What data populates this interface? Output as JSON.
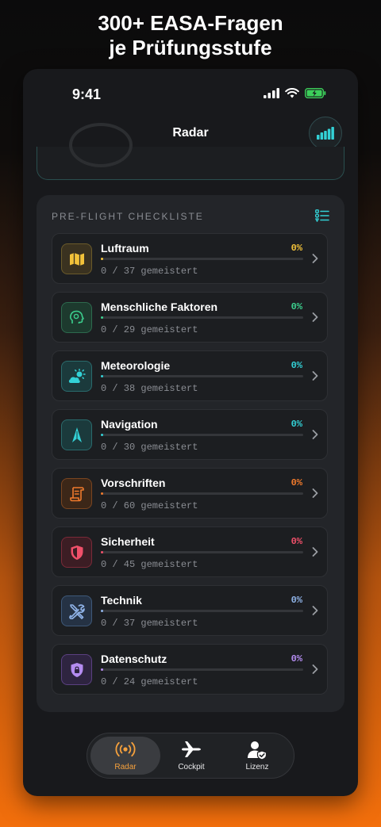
{
  "headline": {
    "line1": "300+ EASA-Fragen",
    "line2": "je Prüfungsstufe"
  },
  "status": {
    "time": "9:41"
  },
  "nav": {
    "title": "Radar"
  },
  "checklist": {
    "title": "PRE-FLIGHT CHECKLISTE",
    "items": [
      {
        "name": "Luftraum",
        "percent": "0%",
        "count": "0 / 37 gemeistert",
        "progress": 0,
        "color": "#f2c23a",
        "bg": "#3a3220",
        "icon": "map-icon"
      },
      {
        "name": "Menschliche Faktoren",
        "percent": "0%",
        "count": "0 / 29 gemeistert",
        "progress": 0,
        "color": "#3ccf8e",
        "bg": "#1d3a2e",
        "icon": "head-icon"
      },
      {
        "name": "Meteorologie",
        "percent": "0%",
        "count": "0 / 38 gemeistert",
        "progress": 0,
        "color": "#33d1d6",
        "bg": "#1b3a3c",
        "icon": "weather-icon"
      },
      {
        "name": "Navigation",
        "percent": "0%",
        "count": "0 / 30 gemeistert",
        "progress": 0,
        "color": "#33d1d6",
        "bg": "#1b3a3c",
        "icon": "compass-arrow-icon"
      },
      {
        "name": "Vorschriften",
        "percent": "0%",
        "count": "0 / 60 gemeistert",
        "progress": 0,
        "color": "#f07a2c",
        "bg": "#3c2718",
        "icon": "scroll-icon"
      },
      {
        "name": "Sicherheit",
        "percent": "0%",
        "count": "0 / 45 gemeistert",
        "progress": 0,
        "color": "#f0506a",
        "bg": "#3c1d24",
        "icon": "shield-icon"
      },
      {
        "name": "Technik",
        "percent": "0%",
        "count": "0 / 37 gemeistert",
        "progress": 0,
        "color": "#8fb3e8",
        "bg": "#253244",
        "icon": "tools-icon"
      },
      {
        "name": "Datenschutz",
        "percent": "0%",
        "count": "0 / 24 gemeistert",
        "progress": 0,
        "color": "#b48cf0",
        "bg": "#2e2440",
        "icon": "lock-shield-icon"
      }
    ]
  },
  "tabs": [
    {
      "label": "Radar",
      "icon": "radar-icon",
      "active": true
    },
    {
      "label": "Cockpit",
      "icon": "plane-icon",
      "active": false
    },
    {
      "label": "Lizenz",
      "icon": "license-user-icon",
      "active": false
    }
  ],
  "colors": {
    "accent_orange": "#f5a03c",
    "teal": "#33d1d6"
  }
}
